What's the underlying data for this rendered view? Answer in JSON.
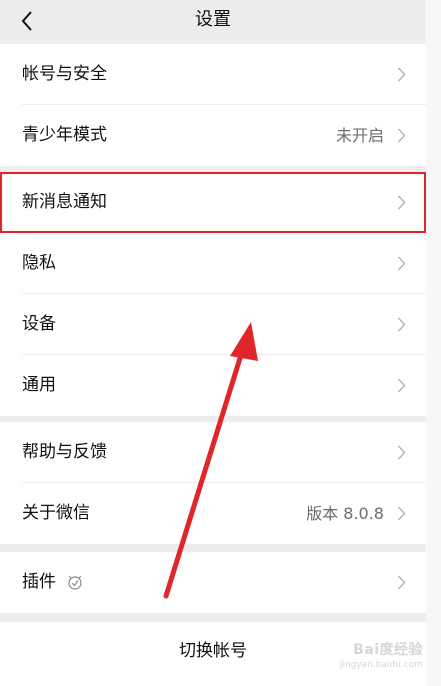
{
  "header": {
    "title": "设置"
  },
  "groups": [
    {
      "rows": [
        {
          "label": "帐号与安全",
          "value": ""
        },
        {
          "label": "青少年模式",
          "value": "未开启"
        }
      ]
    },
    {
      "rows": [
        {
          "label": "新消息通知",
          "value": ""
        },
        {
          "label": "隐私",
          "value": ""
        },
        {
          "label": "设备",
          "value": ""
        },
        {
          "label": "通用",
          "value": ""
        }
      ]
    },
    {
      "rows": [
        {
          "label": "帮助与反馈",
          "value": ""
        },
        {
          "label": "关于微信",
          "value": "版本 8.0.8"
        }
      ]
    },
    {
      "rows": [
        {
          "label": "插件",
          "value": ""
        }
      ]
    }
  ],
  "bottom": {
    "switch_account": "切换帐号"
  },
  "watermark": {
    "logo": "Bai度经验",
    "url": "jingyan.baidu.com"
  },
  "colors": {
    "background": "#ededed",
    "annotation_red": "#e0262a",
    "value_grey": "#6d6d6d"
  }
}
